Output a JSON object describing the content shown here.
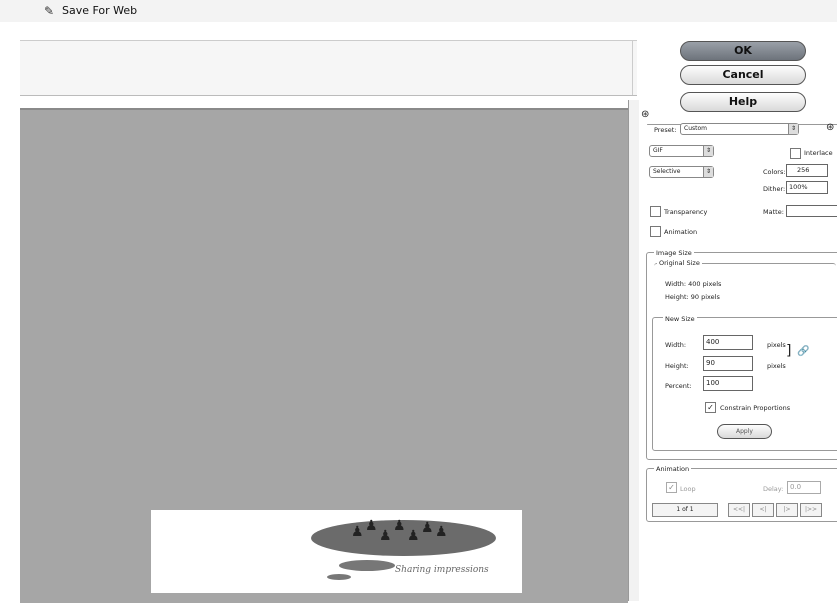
{
  "window": {
    "title": "Save For Web",
    "icon": "photoshop-app-icon"
  },
  "buttons": {
    "ok": "OK",
    "cancel": "Cancel",
    "help": "Help"
  },
  "optimize": {
    "preset_label": "Preset:",
    "preset_value": "Custom",
    "format_value": "GIF",
    "reduction_value": "Selective",
    "interlaced_label": "Interlace",
    "colors_label": "Colors:",
    "colors_value": "256",
    "dither_label": "Dither:",
    "dither_value": "100%",
    "transparency_label": "Transparency",
    "matte_label": "Matte:",
    "animation_label": "Animation"
  },
  "image_size": {
    "title": "Image Size",
    "original_title": "Original Size",
    "orig_width": "Width:  400 pixels",
    "orig_height": "Height:  90 pixels",
    "new_title": "New Size",
    "width_label": "Width:",
    "width_value": "400",
    "height_label": "Height:",
    "height_value": "90",
    "unit": "pixels",
    "percent_label": "Percent:",
    "percent_value": "100",
    "constrain_label": "Constrain Proportions",
    "apply_label": "Apply"
  },
  "animation": {
    "title": "Animation",
    "loop_label": "Loop",
    "delay_label": "Delay:",
    "delay_value": "0.0",
    "frame_counter": "1 of 1",
    "controls": [
      "<<|",
      "<|",
      "|>",
      "|>>"
    ]
  },
  "preview": {
    "tagline": "Sharing impressions"
  }
}
